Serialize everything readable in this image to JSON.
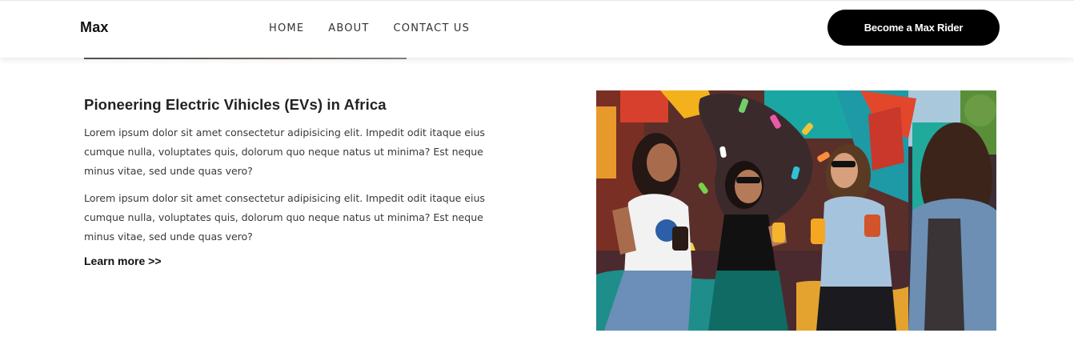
{
  "navbar": {
    "brand": "Max",
    "links": [
      {
        "label": "HOME"
      },
      {
        "label": "ABOUT"
      },
      {
        "label": "CONTACT US"
      }
    ],
    "cta_label": "Become a Max Rider"
  },
  "main": {
    "heading": "Pioneering Electric Vihicles (EVs) in Africa",
    "paragraphs": [
      "Lorem ipsum dolor sit amet consectetur adipisicing elit. Impedit odit itaque eius cumque nulla, voluptates quis, dolorum quo neque natus ut minima? Est neque minus vitae, sed unde quas vero?",
      "Lorem ipsum dolor sit amet consectetur adipisicing elit. Impedit odit itaque eius cumque nulla, voluptates quis, dolorum quo neque natus ut minima? Est neque minus vitae, sed unde quas vero?"
    ],
    "learn_more": "Learn more >>"
  },
  "image": {
    "subject": "four women laughing with drinks in front of a colorful mural"
  },
  "colors": {
    "accent": "#000000",
    "text": "#222222",
    "background": "#ffffff"
  }
}
